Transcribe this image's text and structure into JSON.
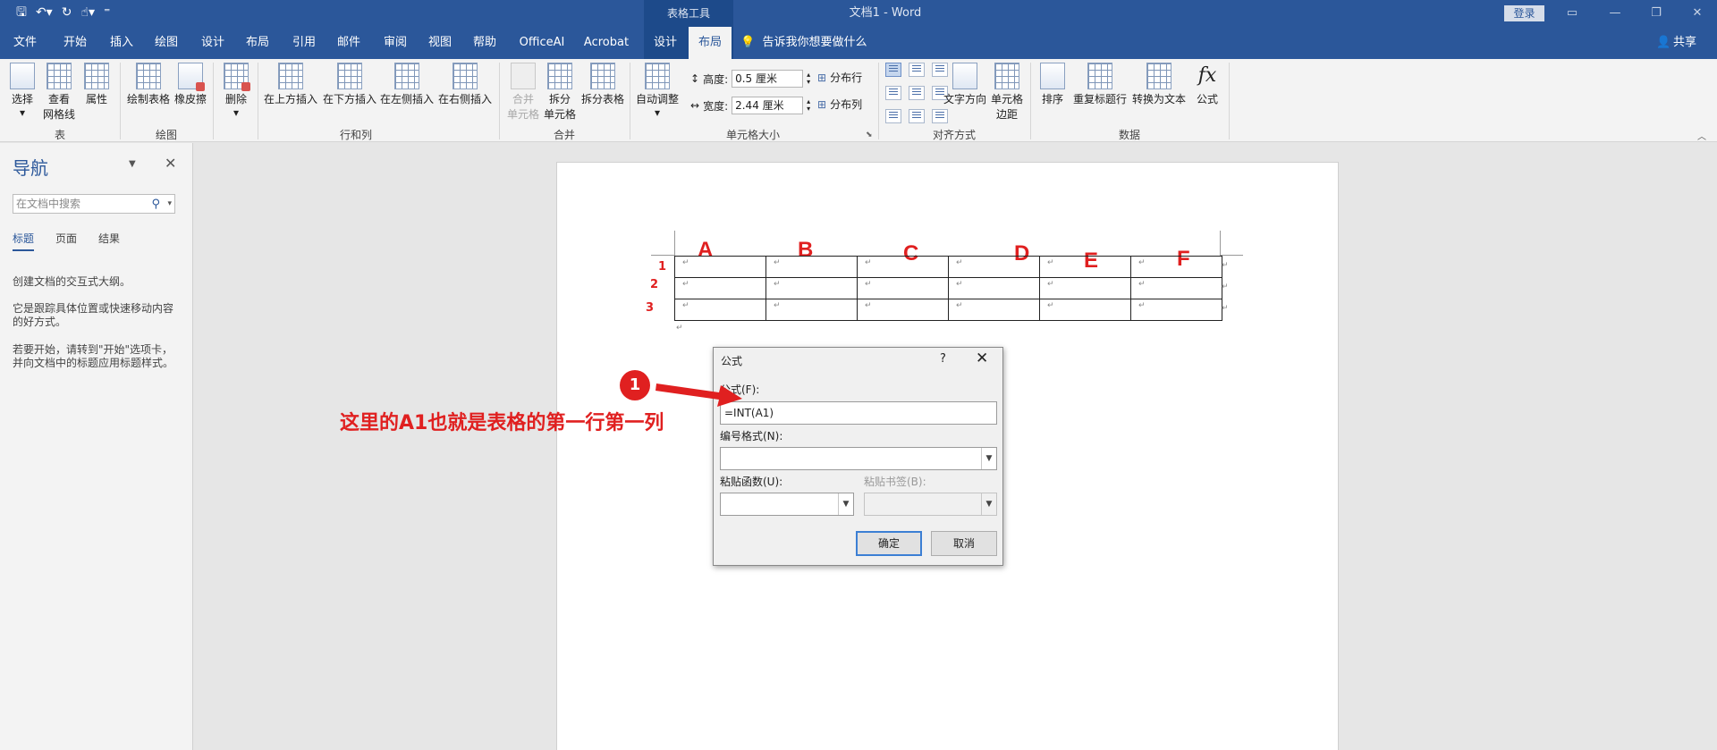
{
  "titlebar": {
    "context_tab_group": "表格工具",
    "document_title": "文档1  -  Word",
    "login": "登录"
  },
  "menu": {
    "tabs": [
      "文件",
      "开始",
      "插入",
      "绘图",
      "设计",
      "布局",
      "引用",
      "邮件",
      "审阅",
      "视图",
      "帮助",
      "OfficeAI",
      "Acrobat",
      "设计",
      "布局"
    ],
    "active_tab": "布局",
    "tell_me": "告诉我你想要做什么",
    "share": "共享"
  },
  "ribbon": {
    "table": {
      "select": "选择",
      "view_gridlines_1": "查看",
      "view_gridlines_2": "网格线",
      "properties": "属性",
      "group": "表"
    },
    "draw": {
      "draw_table": "绘制表格",
      "eraser": "橡皮擦",
      "group": "绘图"
    },
    "rows_cols": {
      "delete": "删除",
      "insert_above": "在上方插入",
      "insert_below": "在下方插入",
      "insert_left": "在左侧插入",
      "insert_right": "在右侧插入",
      "group": "行和列"
    },
    "merge": {
      "merge_1": "合并",
      "merge_2": "单元格",
      "split_1": "拆分",
      "split_2": "单元格",
      "split_table": "拆分表格",
      "group": "合并"
    },
    "cell_size": {
      "autofit": "自动调整",
      "height_label": "高度:",
      "height_value": "0.5 厘米",
      "width_label": "宽度:",
      "width_value": "2.44 厘米",
      "distribute_rows": "分布行",
      "distribute_cols": "分布列",
      "group": "单元格大小"
    },
    "alignment": {
      "text_direction": "文字方向",
      "cell_margins_1": "单元格",
      "cell_margins_2": "边距",
      "group": "对齐方式"
    },
    "data": {
      "sort": "排序",
      "repeat_header": "重复标题行",
      "convert_text": "转换为文本",
      "formula": "公式",
      "group": "数据"
    }
  },
  "nav_pane": {
    "title": "导航",
    "search_placeholder": "在文档中搜索",
    "tabs": [
      "标题",
      "页面",
      "结果"
    ],
    "text_1": "创建文档的交互式大纲。",
    "text_2": "它是跟踪具体位置或快速移动内容的好方式。",
    "text_3": "若要开始，请转到\"开始\"选项卡，并向文档中的标题应用标题样式。"
  },
  "document": {
    "column_letters": [
      "A",
      "B",
      "C",
      "D",
      "E",
      "F"
    ],
    "row_numbers": [
      "1",
      "2",
      "3"
    ],
    "cell_mark": "↵"
  },
  "dialog": {
    "title": "公式",
    "help": "?",
    "formula_label": "公式(F):",
    "formula_value": "=INT(A1)",
    "number_format_label": "编号格式(N):",
    "paste_function_label": "粘贴函数(U):",
    "paste_bookmark_label": "粘贴书签(B):",
    "ok": "确定",
    "cancel": "取消"
  },
  "annotation": {
    "badge": "1",
    "text": "这里的A1也就是表格的第一行第一列"
  }
}
